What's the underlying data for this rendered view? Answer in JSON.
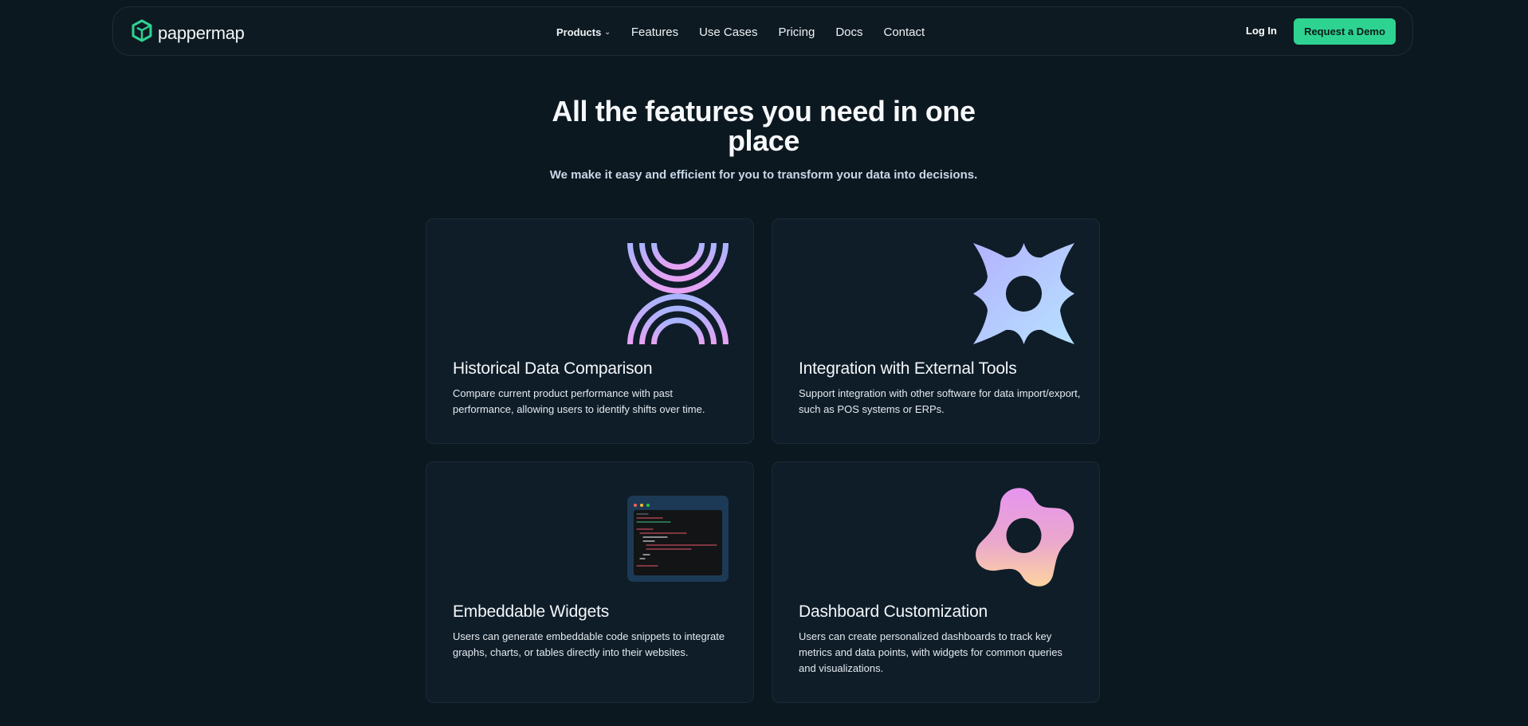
{
  "brand": {
    "name": "pappermap",
    "accent": "#2ed392"
  },
  "nav": {
    "items": [
      {
        "label": "Products",
        "has_dropdown": true
      },
      {
        "label": "Features"
      },
      {
        "label": "Use Cases"
      },
      {
        "label": "Pricing"
      },
      {
        "label": "Docs"
      },
      {
        "label": "Contact"
      }
    ],
    "login_label": "Log In",
    "demo_label": "Request a Demo"
  },
  "hero": {
    "title": "All the features you need in one place",
    "subtitle": "We make it easy and efficient for you to transform your data into decisions."
  },
  "features": [
    {
      "title": "Historical Data Comparison",
      "description": "Compare current product performance with past performance, allowing users to identify shifts over time.",
      "icon": "arches-icon"
    },
    {
      "title": "Integration with External Tools",
      "description": "Support integration with other software for data import/export, such as POS systems or ERPs.",
      "icon": "star-burst-icon"
    },
    {
      "title": "Embeddable Widgets",
      "description": "Users can generate embeddable code snippets to integrate graphs, charts, or tables directly into their websites.",
      "icon": "code-window-icon"
    },
    {
      "title": "Dashboard Customization",
      "description": "Users can create personalized dashboards to track key metrics and data points, with widgets for common queries and visualizations.",
      "icon": "blob-icon"
    }
  ]
}
